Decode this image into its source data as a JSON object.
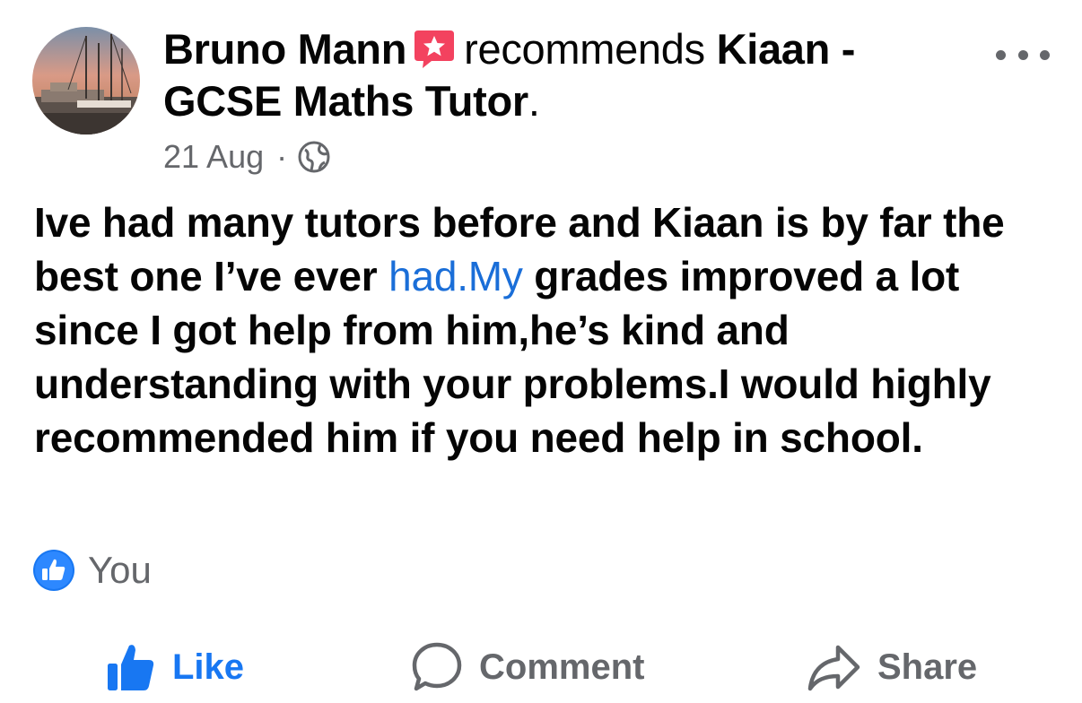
{
  "post": {
    "author": "Bruno Mann",
    "verb": "recommends",
    "page_name": "Kiaan - GCSE Maths Tutor",
    "page_name_suffix": ".",
    "date": "21 Aug",
    "separator": "·",
    "privacy_icon": "globe-icon",
    "text_before_link": "Ive had many tutors before and Kiaan is by far the best one I’ve ever ",
    "link_text": "had.My",
    "text_after_link": " grades improved a lot since I got help from him,he’s kind and understanding with your problems.I would highly recommended him if you need help in school.",
    "link_color": "#1a6ed8"
  },
  "reactions": {
    "icon": "like-reaction-icon",
    "reactor": "You",
    "color": "#1877f2"
  },
  "actions": {
    "like_label": "Like",
    "comment_label": "Comment",
    "share_label": "Share",
    "like_color": "#1877f2",
    "muted_color": "#65676b"
  },
  "badge": {
    "icon": "recommend-star-icon",
    "color": "#f3425f"
  }
}
